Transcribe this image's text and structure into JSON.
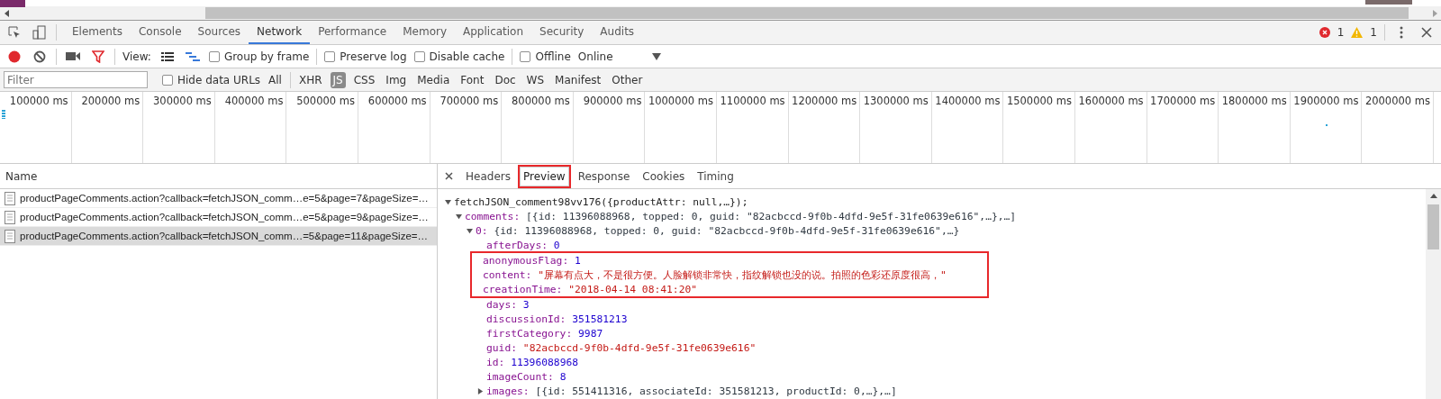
{
  "devtools": {
    "tabs": [
      {
        "label": "Elements",
        "selected": false
      },
      {
        "label": "Console",
        "selected": false
      },
      {
        "label": "Sources",
        "selected": false
      },
      {
        "label": "Network",
        "selected": true
      },
      {
        "label": "Performance",
        "selected": false
      },
      {
        "label": "Memory",
        "selected": false
      },
      {
        "label": "Application",
        "selected": false
      },
      {
        "label": "Security",
        "selected": false
      },
      {
        "label": "Audits",
        "selected": false
      }
    ],
    "error_count": "1",
    "warning_count": "1",
    "toolbar": {
      "recording": true,
      "view_label": "View:",
      "large_rows": false,
      "overview": true,
      "checkboxes": [
        {
          "label": "Group by frame",
          "checked": false
        },
        {
          "label": "Preserve log",
          "checked": false
        },
        {
          "label": "Disable cache",
          "checked": false
        },
        {
          "label": "Offline",
          "checked": false
        }
      ],
      "throttling": "Online"
    },
    "filter_bar": {
      "placeholder": "Filter",
      "hide_data_urls": {
        "label": "Hide data URLs",
        "checked": false
      },
      "types": [
        {
          "label": "All",
          "selected": false
        },
        {
          "label": "XHR",
          "selected": false
        },
        {
          "label": "JS",
          "selected": true
        },
        {
          "label": "CSS",
          "selected": false
        },
        {
          "label": "Img",
          "selected": false
        },
        {
          "label": "Media",
          "selected": false
        },
        {
          "label": "Font",
          "selected": false
        },
        {
          "label": "Doc",
          "selected": false
        },
        {
          "label": "WS",
          "selected": false
        },
        {
          "label": "Manifest",
          "selected": false
        },
        {
          "label": "Other",
          "selected": false
        }
      ]
    },
    "timeline_ticks": [
      "100000 ms",
      "200000 ms",
      "300000 ms",
      "400000 ms",
      "500000 ms",
      "600000 ms",
      "700000 ms",
      "800000 ms",
      "900000 ms",
      "1000000 ms",
      "1100000 ms",
      "1200000 ms",
      "1300000 ms",
      "1400000 ms",
      "1500000 ms",
      "1600000 ms",
      "1700000 ms",
      "1800000 ms",
      "1900000 ms",
      "2000000 ms"
    ],
    "requests": {
      "column": "Name",
      "rows": [
        {
          "name": "productPageComments.action?callback=fetchJSON_comm…e=5&page=7&pageSize=…",
          "selected": false
        },
        {
          "name": "productPageComments.action?callback=fetchJSON_comm…e=5&page=9&pageSize=…",
          "selected": false
        },
        {
          "name": "productPageComments.action?callback=fetchJSON_comm…=5&page=11&pageSize=…",
          "selected": true
        }
      ]
    },
    "detail_tabs": [
      {
        "label": "Headers",
        "selected": false,
        "highlighted": false
      },
      {
        "label": "Preview",
        "selected": true,
        "highlighted": true
      },
      {
        "label": "Response",
        "selected": false,
        "highlighted": false
      },
      {
        "label": "Cookies",
        "selected": false,
        "highlighted": false
      },
      {
        "label": "Timing",
        "selected": false,
        "highlighted": false
      }
    ],
    "preview": [
      {
        "kind": "summary",
        "text": "fetchJSON_comment98vv176({productAttr: null,…});",
        "expanded": true,
        "children": [
          {
            "kind": "object",
            "key": "comments:",
            "value": "[{id: 11396088968, topped: 0, guid: \"82acbccd-9f0b-4dfd-9e5f-31fe0639e616\",…},…]",
            "expanded": true,
            "children": [
              {
                "kind": "object",
                "key": "0:",
                "value": "{id: 11396088968, topped: 0, guid: \"82acbccd-9f0b-4dfd-9e5f-31fe0639e616\",…}",
                "expanded": true,
                "children": [
                  {
                    "kind": "number",
                    "key": "afterDays:",
                    "value": "0",
                    "highlighted": false
                  },
                  {
                    "kind": "number",
                    "key": "anonymousFlag:",
                    "value": "1",
                    "highlighted": true
                  },
                  {
                    "kind": "string",
                    "key": "content:",
                    "value": "\"屏幕有点大，不是很方便。人脸解锁非常快，指纹解锁也没的说。拍照的色彩还原度很高，\"",
                    "highlighted": true
                  },
                  {
                    "kind": "string",
                    "key": "creationTime:",
                    "value": "\"2018-04-14 08:41:20\"",
                    "highlighted": true
                  },
                  {
                    "kind": "number",
                    "key": "days:",
                    "value": "3",
                    "highlighted": false
                  },
                  {
                    "kind": "number",
                    "key": "discussionId:",
                    "value": "351581213",
                    "highlighted": false
                  },
                  {
                    "kind": "number",
                    "key": "firstCategory:",
                    "value": "9987",
                    "highlighted": false
                  },
                  {
                    "kind": "string",
                    "key": "guid:",
                    "value": "\"82acbccd-9f0b-4dfd-9e5f-31fe0639e616\"",
                    "highlighted": false
                  },
                  {
                    "kind": "number",
                    "key": "id:",
                    "value": "11396088968",
                    "highlighted": false
                  },
                  {
                    "kind": "number",
                    "key": "imageCount:",
                    "value": "8",
                    "highlighted": false
                  },
                  {
                    "kind": "object",
                    "key": "images:",
                    "value": "[{id: 551411316, associateId: 351581213, productId: 0,…},…]",
                    "expanded": false
                  }
                ]
              }
            ]
          }
        ]
      }
    ]
  }
}
